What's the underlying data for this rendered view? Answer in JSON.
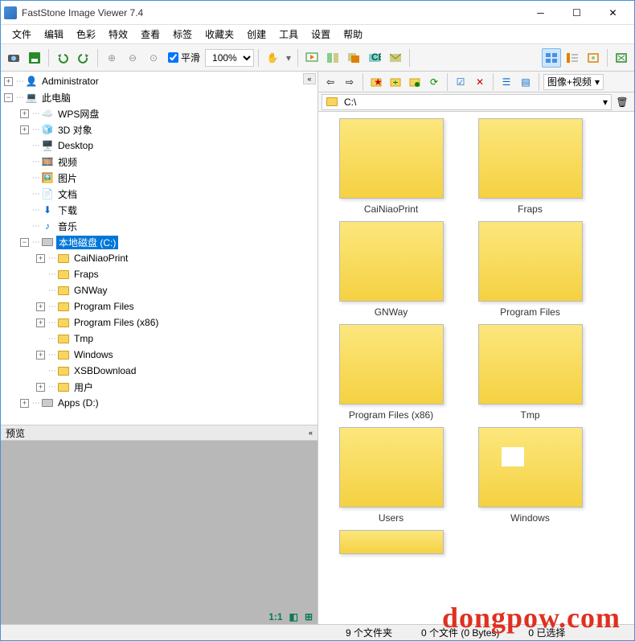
{
  "title": "FastStone Image Viewer 7.4",
  "menu": [
    "文件",
    "编辑",
    "色彩",
    "特效",
    "查看",
    "标签",
    "收藏夹",
    "创建",
    "工具",
    "设置",
    "帮助"
  ],
  "toolbar": {
    "smooth_label": "平滑",
    "zoom_value": "100%"
  },
  "right_toolbar": {
    "filter_label": "图像+视频"
  },
  "address": {
    "path": "C:\\"
  },
  "tree": {
    "root1": "Administrator",
    "root2": "此电脑",
    "children": [
      {
        "label": "WPS网盘",
        "icon": "cloud"
      },
      {
        "label": "3D 对象",
        "icon": "cube"
      },
      {
        "label": "Desktop",
        "icon": "desktop"
      },
      {
        "label": "视频",
        "icon": "video"
      },
      {
        "label": "图片",
        "icon": "image"
      },
      {
        "label": "文档",
        "icon": "doc"
      },
      {
        "label": "下载",
        "icon": "download"
      },
      {
        "label": "音乐",
        "icon": "music"
      }
    ],
    "drive_c": "本地磁盘 (C:)",
    "c_children": [
      "CaiNiaoPrint",
      "Fraps",
      "GNWay",
      "Program Files",
      "Program Files (x86)",
      "Tmp",
      "Windows",
      "XSBDownload",
      "用户"
    ],
    "drive_d": "Apps (D:)"
  },
  "preview": {
    "header": "预览",
    "ratio": "1:1"
  },
  "thumbs": [
    "CaiNiaoPrint",
    "Fraps",
    "GNWay",
    "Program Files",
    "Program Files (x86)",
    "Tmp",
    "Users",
    "Windows"
  ],
  "status": {
    "folders": "9 个文件夹",
    "files": "0 个文件 (0 Bytes)",
    "selected": "0 已选择"
  },
  "watermark": "dongpow.com"
}
